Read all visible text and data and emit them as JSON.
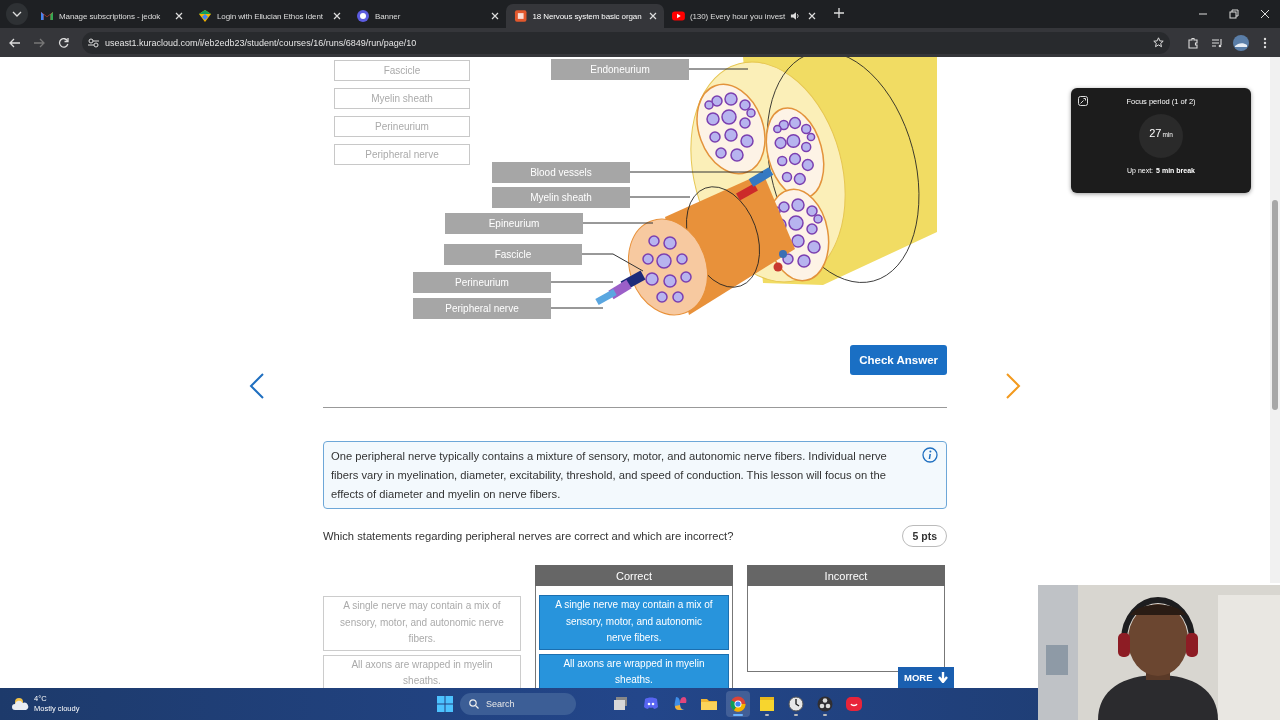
{
  "browser": {
    "tabs": [
      {
        "title": "Manage subscriptions - jedok",
        "kind": "mail",
        "selected": false,
        "audio": false
      },
      {
        "title": "Login with Ellucian Ethos Ident",
        "kind": "ethos",
        "selected": false,
        "audio": false
      },
      {
        "title": "Banner",
        "kind": "banner",
        "selected": false,
        "audio": false
      },
      {
        "title": "18 Nervous system basic organ",
        "kind": "lesson",
        "selected": true,
        "audio": false
      },
      {
        "title": "(130) Every hour you invest",
        "kind": "video",
        "selected": false,
        "audio": true
      }
    ],
    "address": "useast1.kuracloud.com/i/eb2edb23/student/courses/16/runs/6849/run/page/10"
  },
  "page": {
    "word_bank": [
      {
        "text": "Fascicle",
        "placed": true
      },
      {
        "text": "Myelin sheath",
        "placed": true
      },
      {
        "text": "Perineurium",
        "placed": true
      },
      {
        "text": "Peripheral nerve",
        "placed": true
      }
    ],
    "diagram_labels": [
      "Endoneurium",
      "Blood vessels",
      "Myelin sheath",
      "Epineurium",
      "Fascicle",
      "Perineurium",
      "Peripheral nerve"
    ],
    "check_button": "Check Answer",
    "info_text": "One peripheral nerve typically contains a mixture of sensory, motor, and autonomic nerve fibers. Individual nerve fibers vary in myelination, diameter, excitability, threshold, and speed of conduction. This lesson will focus on the effects of diameter and myelin on nerve fibers.",
    "question": "Which statements regarding peripheral nerves are correct and which are incorrect?",
    "points": "5 pts",
    "statements": [
      {
        "text": "A single nerve may contain a mix of sensory, motor, and autonomic nerve fibers.",
        "placed": true
      },
      {
        "text": "All axons are wrapped in myelin sheaths.",
        "placed": true
      }
    ],
    "columns": [
      {
        "title": "Correct",
        "items": [
          "A single nerve may contain a mix of sensory, motor, and autonomic nerve fibers.",
          "All axons are wrapped in myelin sheaths."
        ]
      },
      {
        "title": "Incorrect"
      }
    ],
    "more_button": "MORE"
  },
  "focus_timer": {
    "title": "Focus period (1 of 2)",
    "minutes": "27",
    "unit": "min",
    "up_next_label": "Up next:",
    "up_next": "5 min break"
  },
  "taskbar": {
    "weather": {
      "temperature": "4°C",
      "condition": "Mostly cloudy"
    },
    "search": "Search",
    "apps": [
      {
        "kind": "stack",
        "open": false,
        "selected": false
      },
      {
        "kind": "chat",
        "open": false,
        "selected": false
      },
      {
        "kind": "sparkle",
        "open": false,
        "selected": false
      },
      {
        "kind": "folder",
        "open": false,
        "selected": false
      },
      {
        "kind": "browser",
        "open": true,
        "selected": true
      },
      {
        "kind": "note",
        "open": true,
        "selected": false
      },
      {
        "kind": "clock",
        "open": true,
        "selected": false
      },
      {
        "kind": "aperture",
        "open": true,
        "selected": false
      },
      {
        "kind": "smile",
        "open": false,
        "selected": false
      }
    ]
  }
}
